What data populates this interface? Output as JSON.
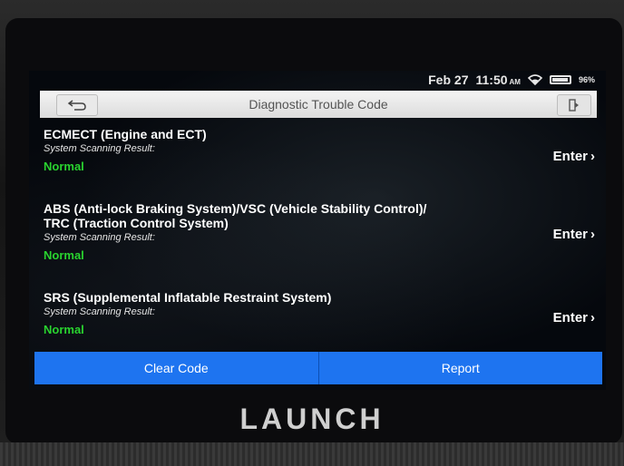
{
  "status_bar": {
    "date": "Feb 27",
    "time": "11:50",
    "am_pm": "AM",
    "battery": "96%",
    "battery_level": 0.96
  },
  "header": {
    "title": "Diagnostic Trouble Code"
  },
  "systems": [
    {
      "name_line1": "ECMECT (Engine and ECT)",
      "name_line2": "",
      "result_label": "System Scanning Result:",
      "status": "Normal",
      "action": "Enter"
    },
    {
      "name_line1": "ABS (Anti-lock Braking System)/VSC (Vehicle Stability Control)/",
      "name_line2": "TRC (Traction Control System)",
      "result_label": "System Scanning Result:",
      "status": "Normal",
      "action": "Enter"
    },
    {
      "name_line1": "SRS (Supplemental Inflatable Restraint System)",
      "name_line2": "",
      "result_label": "System Scanning Result:",
      "status": "Normal",
      "action": "Enter"
    }
  ],
  "footer": {
    "clear_code_label": "Clear Code",
    "report_label": "Report"
  },
  "brand": "LAUNCH",
  "colors": {
    "status_normal": "#29d32f",
    "button_blue": "#1e74f0"
  }
}
